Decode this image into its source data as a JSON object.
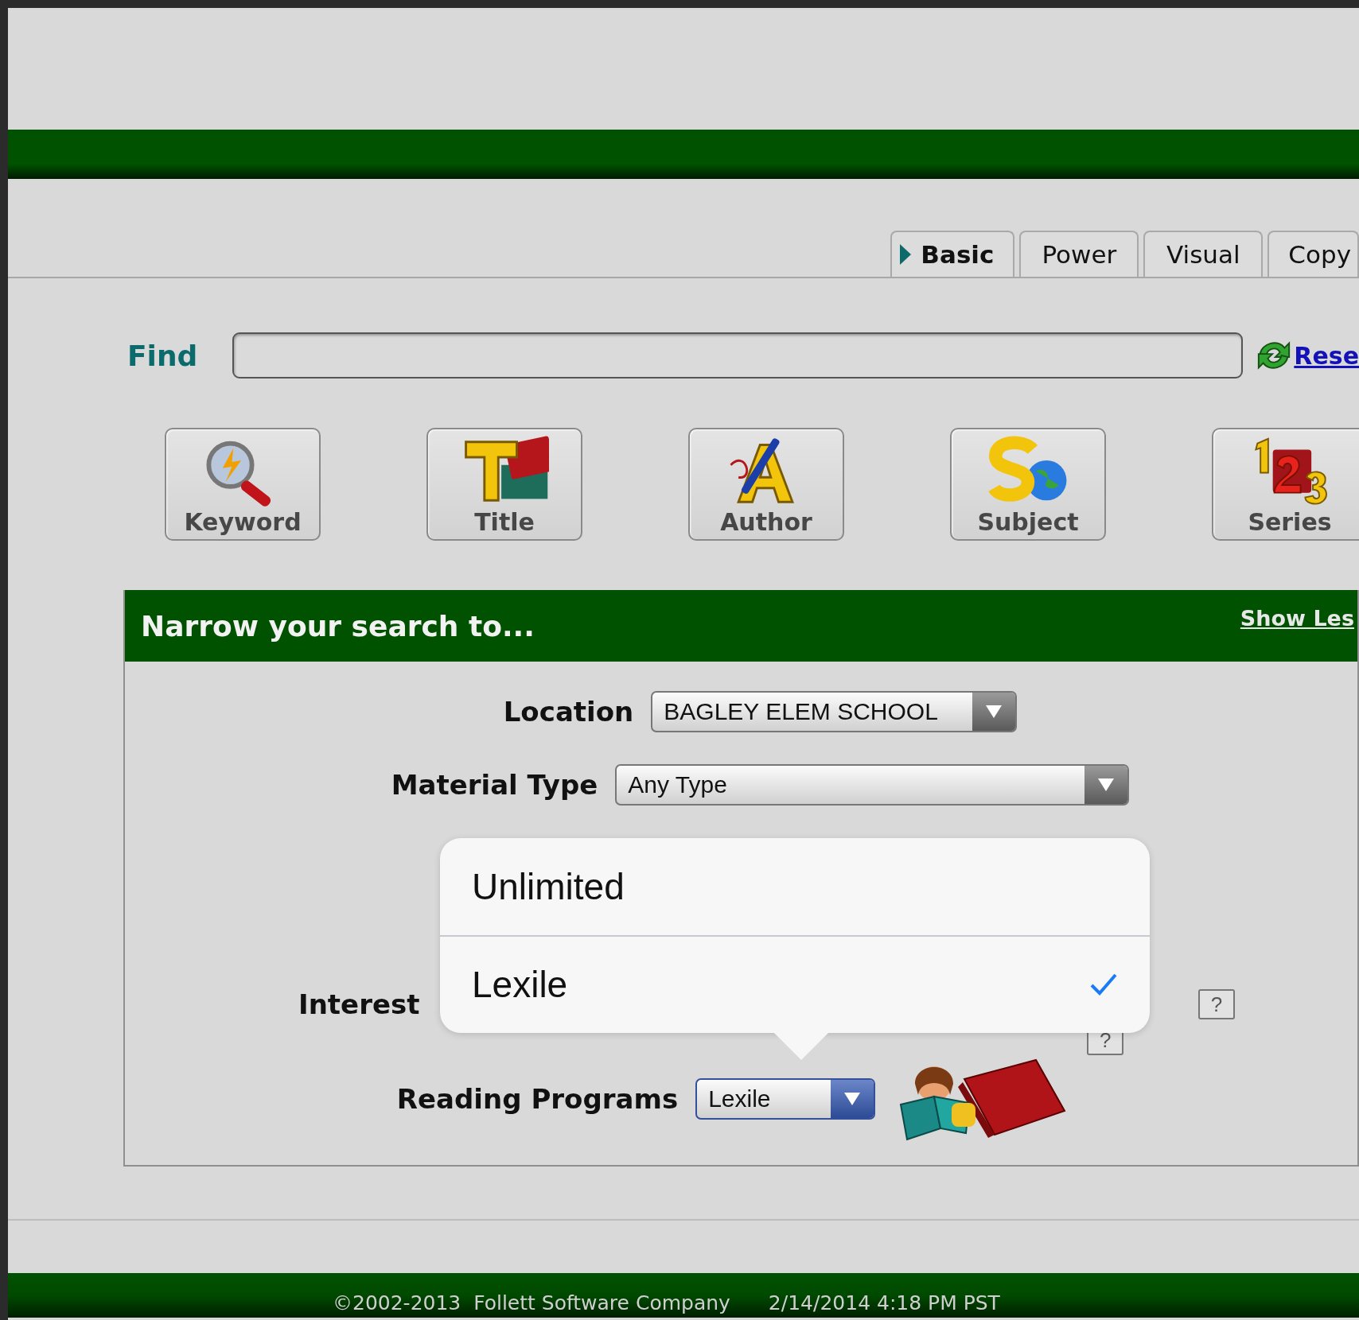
{
  "tabs": [
    {
      "label": "Basic",
      "selected": true
    },
    {
      "label": "Power",
      "selected": false
    },
    {
      "label": "Visual",
      "selected": false
    },
    {
      "label": "Copy",
      "selected": false
    }
  ],
  "find": {
    "label": "Find",
    "reset_link": "Rese"
  },
  "search_buttons": [
    {
      "label": "Keyword",
      "kind": "keyword"
    },
    {
      "label": "Title",
      "kind": "title"
    },
    {
      "label": "Author",
      "kind": "author"
    },
    {
      "label": "Subject",
      "kind": "subject"
    },
    {
      "label": "Series",
      "kind": "series"
    }
  ],
  "narrow": {
    "title": "Narrow your search to...",
    "toggle_link": "Show Les",
    "rows": [
      {
        "kind": "select",
        "label": "Location",
        "value": "BAGLEY ELEM SCHOOL"
      },
      {
        "kind": "select",
        "label": "Material Type",
        "value": "Any Type"
      },
      {
        "kind": "covered",
        "label": "Interest",
        "help": "?"
      },
      {
        "kind": "program",
        "label": "Reading Programs",
        "value": "Lexile",
        "focused": true,
        "help": "?"
      }
    ]
  },
  "picker": {
    "options": [
      {
        "label": "Unlimited",
        "selected": false
      },
      {
        "label": "Lexile",
        "selected": true
      }
    ]
  },
  "footer": {
    "copyright": "©2002-2013  Follett Software Company",
    "timestamp": "2/14/2014 4:18 PM PST"
  }
}
